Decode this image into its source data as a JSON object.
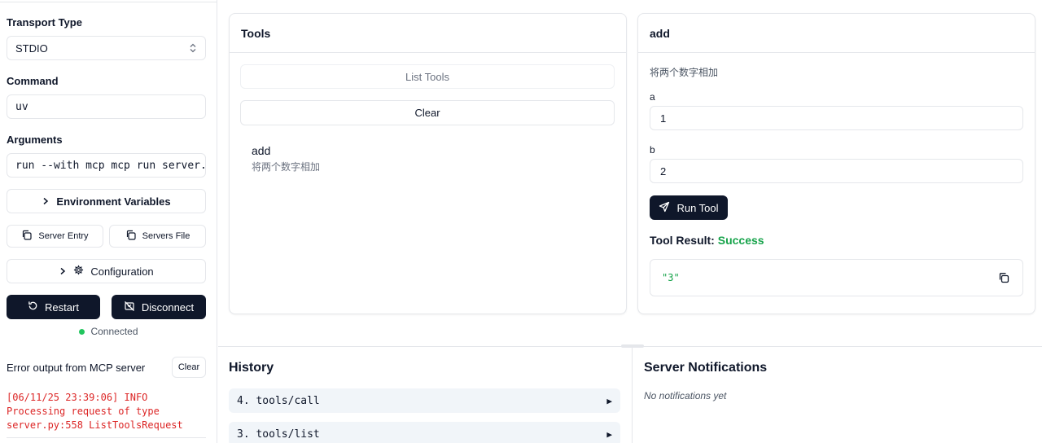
{
  "sidebar": {
    "transport_label": "Transport Type",
    "transport_value": "STDIO",
    "command_label": "Command",
    "command_value": "uv",
    "arguments_label": "Arguments",
    "arguments_value": "run --with mcp mcp run server.p",
    "env_button": "Environment Variables",
    "server_entry_button": "Server Entry",
    "servers_file_button": "Servers File",
    "configuration_button": "Configuration",
    "restart_button": "Restart",
    "disconnect_button": "Disconnect",
    "status_text": "Connected",
    "status_color": "#22c55e",
    "error_title": "Error output from MCP server",
    "error_clear_button": "Clear",
    "error_log": "[06/11/25 23:39:06] INFO\nProcessing request of type\nserver.py:558 ListToolsRequest"
  },
  "tools_panel": {
    "title": "Tools",
    "list_tools_button": "List Tools",
    "clear_button": "Clear",
    "tools": [
      {
        "name": "add",
        "description": "将两个数字相加"
      }
    ]
  },
  "tool_detail": {
    "title": "add",
    "description": "将两个数字相加",
    "param_a_label": "a",
    "param_a_value": "1",
    "param_b_label": "b",
    "param_b_value": "2",
    "run_button": "Run Tool",
    "result_label": "Tool Result:",
    "result_status": "Success",
    "result_status_color": "#16a34a",
    "result_value": "\"3\""
  },
  "history": {
    "title": "History",
    "items": [
      {
        "label": "4. tools/call"
      },
      {
        "label": "3. tools/list"
      }
    ]
  },
  "notifications": {
    "title": "Server Notifications",
    "empty_text": "No notifications yet"
  },
  "icons": {
    "chevron_updown": "chevron-updown-icon",
    "chevron_right": "chevron-right-icon",
    "copy": "copy-icon",
    "gear": "gear-icon",
    "restart": "restart-icon",
    "disconnect": "unplug-icon",
    "send": "send-icon",
    "expand_arrow": "expand-arrow-icon"
  }
}
